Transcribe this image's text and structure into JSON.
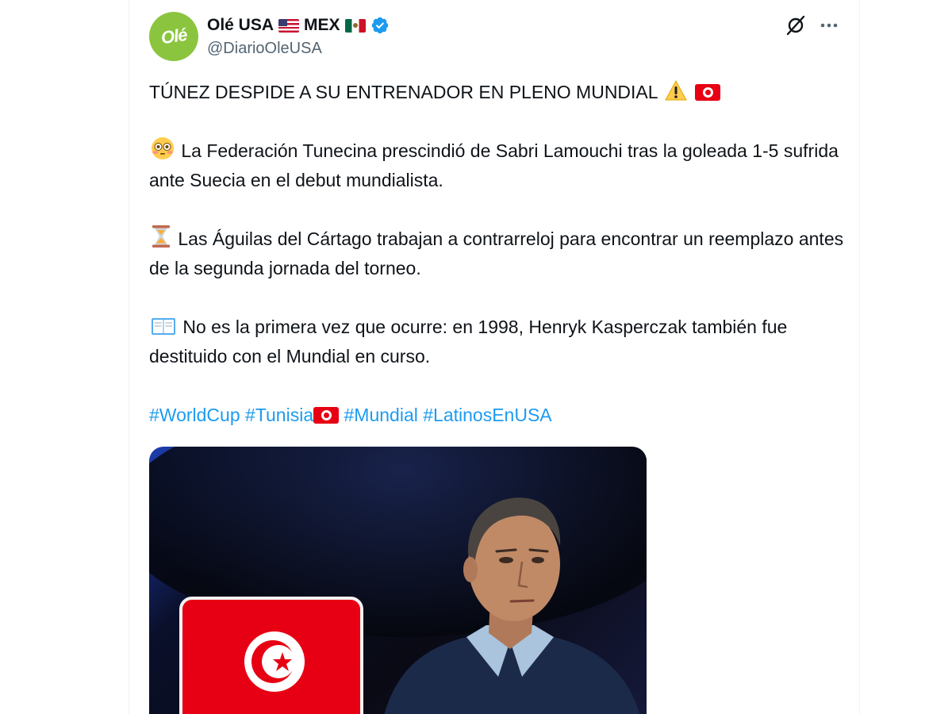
{
  "account": {
    "display_name": "Olé USA",
    "country_label": "MEX",
    "handle": "@DiarioOleUSA",
    "avatar_text": "Olé"
  },
  "tweet": {
    "headline": "TÚNEZ DESPIDE A SU ENTRENADOR EN PLENO MUNDIAL",
    "paragraph_1": "La Federación Tunecina prescindió de Sabri Lamouchi tras la goleada 1-5 sufrida ante Suecia en el debut mundialista.",
    "paragraph_2": "Las Águilas del Cártago trabajan a contrarreloj para encontrar un reemplazo antes de la segunda jornada del torneo.",
    "paragraph_3": "No es la primera vez que ocurre: en 1998, Henryk Kasperczak también fue destituido con el Mundial en curso.",
    "hashtags": [
      "#WorldCup",
      "#Tunisia",
      "#Mundial",
      "#LatinosEnUSA"
    ]
  },
  "icons": {
    "verified": "verified-badge-icon",
    "grok": "grok-icon",
    "more": "more-options-icon",
    "warning": "warning-emoji",
    "flushed": "flushed-face-emoji",
    "hourglass": "hourglass-emoji",
    "book": "open-book-emoji",
    "flag_tunisia": "tunisia-flag-emoji"
  },
  "colors": {
    "link": "#1d9bf0",
    "secondary_text": "#536471",
    "avatar_bg": "#8bc53f",
    "tunisia_red": "#e70013"
  }
}
